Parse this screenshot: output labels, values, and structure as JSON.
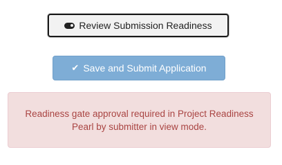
{
  "review_button": {
    "label": "Review Submission Readiness",
    "icon": "toggle-on-icon"
  },
  "submit_button": {
    "label": "Save and Submit Application",
    "icon": "check-icon",
    "color": "#7eadd6"
  },
  "alert": {
    "message": "Readiness gate approval required in Project Readiness Pearl by submitter in view mode.",
    "background": "#f2dede",
    "text_color": "#a94442"
  }
}
